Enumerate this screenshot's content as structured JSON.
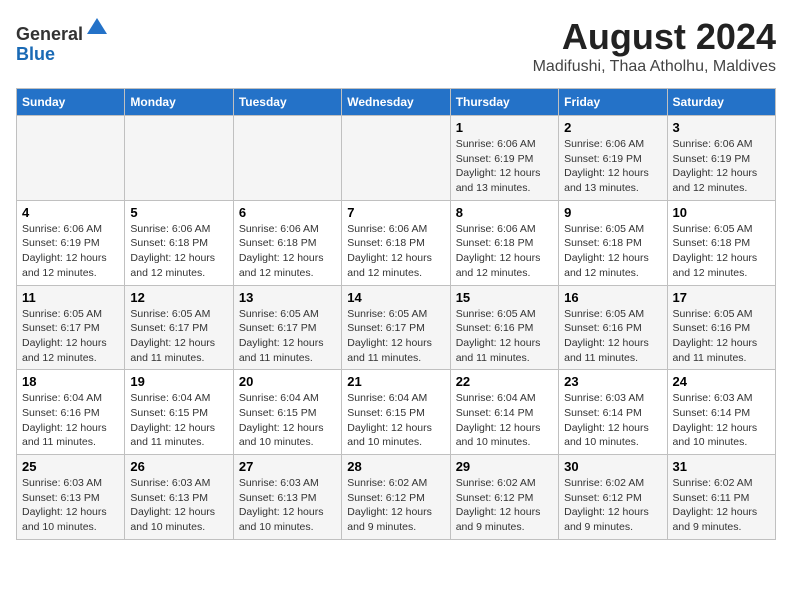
{
  "header": {
    "logo_line1": "General",
    "logo_line2": "Blue",
    "main_title": "August 2024",
    "sub_title": "Madifushi, Thaa Atholhu, Maldives"
  },
  "days_of_week": [
    "Sunday",
    "Monday",
    "Tuesday",
    "Wednesday",
    "Thursday",
    "Friday",
    "Saturday"
  ],
  "weeks": [
    [
      {
        "day": "",
        "detail": ""
      },
      {
        "day": "",
        "detail": ""
      },
      {
        "day": "",
        "detail": ""
      },
      {
        "day": "",
        "detail": ""
      },
      {
        "day": "1",
        "detail": "Sunrise: 6:06 AM\nSunset: 6:19 PM\nDaylight: 12 hours\nand 13 minutes."
      },
      {
        "day": "2",
        "detail": "Sunrise: 6:06 AM\nSunset: 6:19 PM\nDaylight: 12 hours\nand 13 minutes."
      },
      {
        "day": "3",
        "detail": "Sunrise: 6:06 AM\nSunset: 6:19 PM\nDaylight: 12 hours\nand 12 minutes."
      }
    ],
    [
      {
        "day": "4",
        "detail": "Sunrise: 6:06 AM\nSunset: 6:19 PM\nDaylight: 12 hours\nand 12 minutes."
      },
      {
        "day": "5",
        "detail": "Sunrise: 6:06 AM\nSunset: 6:18 PM\nDaylight: 12 hours\nand 12 minutes."
      },
      {
        "day": "6",
        "detail": "Sunrise: 6:06 AM\nSunset: 6:18 PM\nDaylight: 12 hours\nand 12 minutes."
      },
      {
        "day": "7",
        "detail": "Sunrise: 6:06 AM\nSunset: 6:18 PM\nDaylight: 12 hours\nand 12 minutes."
      },
      {
        "day": "8",
        "detail": "Sunrise: 6:06 AM\nSunset: 6:18 PM\nDaylight: 12 hours\nand 12 minutes."
      },
      {
        "day": "9",
        "detail": "Sunrise: 6:05 AM\nSunset: 6:18 PM\nDaylight: 12 hours\nand 12 minutes."
      },
      {
        "day": "10",
        "detail": "Sunrise: 6:05 AM\nSunset: 6:18 PM\nDaylight: 12 hours\nand 12 minutes."
      }
    ],
    [
      {
        "day": "11",
        "detail": "Sunrise: 6:05 AM\nSunset: 6:17 PM\nDaylight: 12 hours\nand 12 minutes."
      },
      {
        "day": "12",
        "detail": "Sunrise: 6:05 AM\nSunset: 6:17 PM\nDaylight: 12 hours\nand 11 minutes."
      },
      {
        "day": "13",
        "detail": "Sunrise: 6:05 AM\nSunset: 6:17 PM\nDaylight: 12 hours\nand 11 minutes."
      },
      {
        "day": "14",
        "detail": "Sunrise: 6:05 AM\nSunset: 6:17 PM\nDaylight: 12 hours\nand 11 minutes."
      },
      {
        "day": "15",
        "detail": "Sunrise: 6:05 AM\nSunset: 6:16 PM\nDaylight: 12 hours\nand 11 minutes."
      },
      {
        "day": "16",
        "detail": "Sunrise: 6:05 AM\nSunset: 6:16 PM\nDaylight: 12 hours\nand 11 minutes."
      },
      {
        "day": "17",
        "detail": "Sunrise: 6:05 AM\nSunset: 6:16 PM\nDaylight: 12 hours\nand 11 minutes."
      }
    ],
    [
      {
        "day": "18",
        "detail": "Sunrise: 6:04 AM\nSunset: 6:16 PM\nDaylight: 12 hours\nand 11 minutes."
      },
      {
        "day": "19",
        "detail": "Sunrise: 6:04 AM\nSunset: 6:15 PM\nDaylight: 12 hours\nand 11 minutes."
      },
      {
        "day": "20",
        "detail": "Sunrise: 6:04 AM\nSunset: 6:15 PM\nDaylight: 12 hours\nand 10 minutes."
      },
      {
        "day": "21",
        "detail": "Sunrise: 6:04 AM\nSunset: 6:15 PM\nDaylight: 12 hours\nand 10 minutes."
      },
      {
        "day": "22",
        "detail": "Sunrise: 6:04 AM\nSunset: 6:14 PM\nDaylight: 12 hours\nand 10 minutes."
      },
      {
        "day": "23",
        "detail": "Sunrise: 6:03 AM\nSunset: 6:14 PM\nDaylight: 12 hours\nand 10 minutes."
      },
      {
        "day": "24",
        "detail": "Sunrise: 6:03 AM\nSunset: 6:14 PM\nDaylight: 12 hours\nand 10 minutes."
      }
    ],
    [
      {
        "day": "25",
        "detail": "Sunrise: 6:03 AM\nSunset: 6:13 PM\nDaylight: 12 hours\nand 10 minutes."
      },
      {
        "day": "26",
        "detail": "Sunrise: 6:03 AM\nSunset: 6:13 PM\nDaylight: 12 hours\nand 10 minutes."
      },
      {
        "day": "27",
        "detail": "Sunrise: 6:03 AM\nSunset: 6:13 PM\nDaylight: 12 hours\nand 10 minutes."
      },
      {
        "day": "28",
        "detail": "Sunrise: 6:02 AM\nSunset: 6:12 PM\nDaylight: 12 hours\nand 9 minutes."
      },
      {
        "day": "29",
        "detail": "Sunrise: 6:02 AM\nSunset: 6:12 PM\nDaylight: 12 hours\nand 9 minutes."
      },
      {
        "day": "30",
        "detail": "Sunrise: 6:02 AM\nSunset: 6:12 PM\nDaylight: 12 hours\nand 9 minutes."
      },
      {
        "day": "31",
        "detail": "Sunrise: 6:02 AM\nSunset: 6:11 PM\nDaylight: 12 hours\nand 9 minutes."
      }
    ]
  ]
}
